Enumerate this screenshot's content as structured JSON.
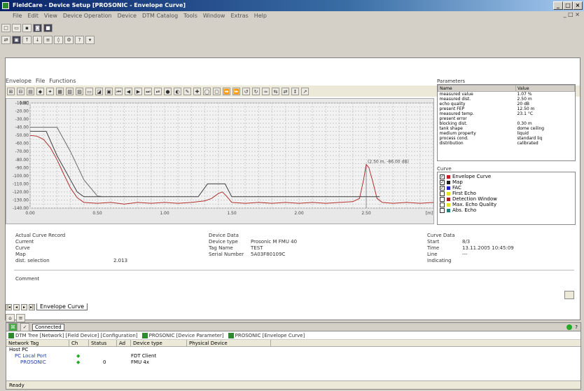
{
  "window": {
    "title": "FieldCare - Device Setup [PROSONIC - Envelope Curve]",
    "minimize": "_",
    "maximize": "□",
    "close": "×"
  },
  "menu": [
    "File",
    "Edit",
    "View",
    "Device Operation",
    "Device",
    "DTM Catalog",
    "Tools",
    "Window",
    "Extras",
    "Help"
  ],
  "mdi_controls": "_ □ ×",
  "doc_tabs": [
    "Envelope",
    "File",
    "Functions"
  ],
  "chart_data": {
    "type": "line",
    "ylabel": "[dB]",
    "xlabel": "[m]",
    "ylim": [
      -140,
      -10
    ],
    "xlim": [
      0,
      3.0
    ],
    "y_ticks": [
      "-10.00",
      "-20.00",
      "-30.00",
      "-40.00",
      "-50.00",
      "-60.00",
      "-70.00",
      "-80.00",
      "-90.00",
      "-100.00",
      "-110.00",
      "-120.00",
      "-130.00",
      "-140.00"
    ],
    "x_ticks": [
      "0.00",
      "0.50",
      "1.00",
      "1.50",
      "2.00",
      "2.50"
    ],
    "annotation": "(2.50 m, -86.00 dB)",
    "series": [
      {
        "name": "Envelope Curve",
        "color": "#b03030",
        "points": [
          [
            0.0,
            -50
          ],
          [
            0.05,
            -51
          ],
          [
            0.1,
            -55
          ],
          [
            0.15,
            -65
          ],
          [
            0.2,
            -80
          ],
          [
            0.25,
            -98
          ],
          [
            0.3,
            -115
          ],
          [
            0.35,
            -127
          ],
          [
            0.4,
            -133
          ],
          [
            0.5,
            -134
          ],
          [
            0.6,
            -133
          ],
          [
            0.7,
            -135
          ],
          [
            0.8,
            -133
          ],
          [
            0.9,
            -134
          ],
          [
            1.0,
            -133
          ],
          [
            1.1,
            -134
          ],
          [
            1.2,
            -133
          ],
          [
            1.3,
            -131
          ],
          [
            1.35,
            -128
          ],
          [
            1.4,
            -122
          ],
          [
            1.43,
            -120
          ],
          [
            1.46,
            -125
          ],
          [
            1.5,
            -133
          ],
          [
            1.6,
            -134
          ],
          [
            1.7,
            -133
          ],
          [
            1.8,
            -134
          ],
          [
            1.9,
            -133
          ],
          [
            2.0,
            -134
          ],
          [
            2.1,
            -133
          ],
          [
            2.2,
            -134
          ],
          [
            2.3,
            -133
          ],
          [
            2.4,
            -132
          ],
          [
            2.45,
            -128
          ],
          [
            2.48,
            -105
          ],
          [
            2.5,
            -86
          ],
          [
            2.52,
            -90
          ],
          [
            2.55,
            -108
          ],
          [
            2.58,
            -128
          ],
          [
            2.62,
            -133
          ],
          [
            2.7,
            -134
          ],
          [
            2.8,
            -133
          ],
          [
            2.9,
            -134
          ],
          [
            3.0,
            -133
          ]
        ]
      },
      {
        "name": "Map",
        "color": "#404040",
        "points": [
          [
            0.0,
            -45
          ],
          [
            0.12,
            -45
          ],
          [
            0.2,
            -75
          ],
          [
            0.3,
            -105
          ],
          [
            0.35,
            -120
          ],
          [
            0.4,
            -126
          ],
          [
            1.25,
            -126
          ],
          [
            1.32,
            -110
          ],
          [
            1.45,
            -110
          ],
          [
            1.5,
            -126
          ],
          [
            2.6,
            -126
          ]
        ]
      },
      {
        "name": "FAC",
        "color": "#6a6a6a",
        "points": [
          [
            0.0,
            -40
          ],
          [
            0.2,
            -40
          ],
          [
            0.3,
            -70
          ],
          [
            0.4,
            -105
          ],
          [
            0.5,
            -125
          ],
          [
            0.55,
            -126
          ]
        ]
      }
    ]
  },
  "parameters": {
    "title": "Parameters",
    "headers": [
      "Name",
      "Value"
    ],
    "rows": [
      [
        "measured value",
        "1.07 %"
      ],
      [
        "measured dist.",
        "2.50 m"
      ],
      [
        "echo quality",
        "20 dB"
      ],
      [
        "present FEP",
        "12.50 m"
      ],
      [
        "measured temp.",
        "23.1 °C"
      ],
      [
        "present error",
        ""
      ],
      [
        "blocking dist.",
        "0.30 m"
      ],
      [
        "tank shape",
        "dome ceiling"
      ],
      [
        "medium property",
        "liquid"
      ],
      [
        "process cond.",
        "standard liq"
      ],
      [
        "distribution",
        "calibrated"
      ]
    ]
  },
  "legend": {
    "title": "Curve",
    "items": [
      {
        "label": "Envelope Curve",
        "checked": true,
        "color": "#c02020"
      },
      {
        "label": "Map",
        "checked": true,
        "color": "#202020"
      },
      {
        "label": "FAC",
        "checked": true,
        "color": "#2020c0"
      },
      {
        "label": "First Echo",
        "checked": false,
        "color": "#e8e030"
      },
      {
        "label": "Detection Window",
        "checked": false,
        "color": "#a02020"
      },
      {
        "label": "Max. Echo Quality",
        "checked": false,
        "color": "#e8e030"
      },
      {
        "label": "Abs. Echo",
        "checked": false,
        "color": "#208080"
      }
    ]
  },
  "info_left": {
    "title": "Actual Curve Record",
    "rows": [
      [
        "Current",
        ""
      ],
      [
        "Curve",
        ""
      ],
      [
        "Map",
        ""
      ],
      [
        "dist. selection",
        "2.013"
      ]
    ]
  },
  "info_mid": {
    "title": "Device Data",
    "rows": [
      [
        "Device type",
        "Prosonic M FMU 40"
      ],
      [
        "Tag Name",
        "TEST"
      ],
      [
        "Serial Number",
        "5A03F80109C"
      ]
    ]
  },
  "info_right": {
    "title": "Curve Data",
    "rows": [
      [
        "Start",
        "8/3"
      ],
      [
        "Time",
        "13.11.2005 10:45:09"
      ],
      [
        "Line Indicating",
        "---"
      ]
    ]
  },
  "comment_label": "Comment",
  "sheet_tab": "Envelope Curve",
  "connect_status": "Connected",
  "bottom_tabs": [
    "DTM Tree [Network] [Field Device] [Configuration]",
    "PROSONIC [Device Parameter]",
    "PROSONIC [Envelope Curve]"
  ],
  "bottom_headers": [
    "Network Tag",
    "Ch",
    "Status",
    "Ad",
    "Device type",
    "Physical Device"
  ],
  "tree": [
    {
      "name": "Host PC",
      "status": "",
      "ch": "",
      "type": ""
    },
    {
      "name": "PC Local Port",
      "status": "◆",
      "ch": "",
      "type": "FDT Client"
    },
    {
      "name": "PROSONIC",
      "status": "◆",
      "ch": "0",
      "type": "FMU 4x"
    }
  ],
  "statusbar": "Ready"
}
